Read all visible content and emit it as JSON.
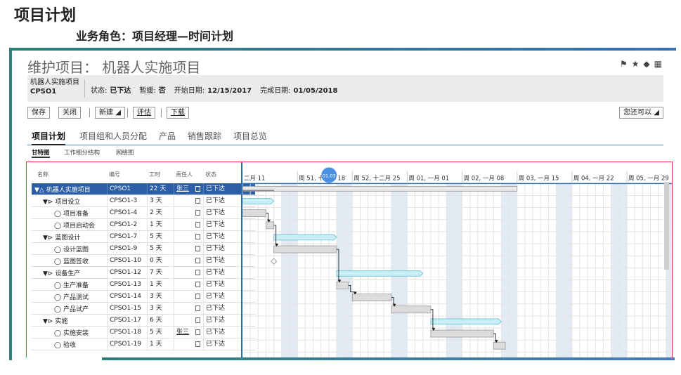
{
  "slide": {
    "title": "项目计划",
    "subtitle": "业务角色：项目经理—时间计划"
  },
  "app": {
    "title": "维护项目： 机器人实施项目",
    "header_icons": [
      "flag-icon",
      "star-icon",
      "tag-icon",
      "grid-icon"
    ],
    "info": {
      "name": "机器人实施项目",
      "code": "CPSO1",
      "status_label": "状态:",
      "status_value": "已下达",
      "pause_label": "暂缓:",
      "pause_value": "否",
      "start_label": "开始日期:",
      "start_value": "12/15/2017",
      "end_label": "完成日期:",
      "end_value": "01/05/2018"
    },
    "toolbar": {
      "save": "保存",
      "close": "关闭",
      "new": "新建",
      "evaluate": "评估",
      "download": "下载",
      "more": "您还可以"
    },
    "tabs": [
      "项目计划",
      "项目组和人员分配",
      "产品",
      "销售跟踪",
      "项目总览"
    ],
    "subtabs": [
      "甘特图",
      "工作细分结构",
      "网络图"
    ]
  },
  "table": {
    "columns": [
      "名称",
      "编号",
      "工时",
      "责任人",
      "状态"
    ],
    "rows": [
      {
        "name": "机器人实施项目",
        "code": "CPSO1",
        "dur": "22 天",
        "owner": "张三",
        "status": "已下达",
        "level": 0,
        "type": "project"
      },
      {
        "name": "项目设立",
        "code": "CPSO1-3",
        "dur": "3 天",
        "owner": "",
        "status": "已下达",
        "level": 1,
        "type": "phase"
      },
      {
        "name": "项目准备",
        "code": "CPSO1-4",
        "dur": "2 天",
        "owner": "",
        "status": "已下达",
        "level": 2,
        "type": "task"
      },
      {
        "name": "项目启动会",
        "code": "CPSO1-2",
        "dur": "1 天",
        "owner": "",
        "status": "已下达",
        "level": 2,
        "type": "task"
      },
      {
        "name": "蓝图设计",
        "code": "CPSO1-7",
        "dur": "5 天",
        "owner": "",
        "status": "已下达",
        "level": 1,
        "type": "phase"
      },
      {
        "name": "设计蓝图",
        "code": "CPSO1-9",
        "dur": "5 天",
        "owner": "",
        "status": "已下达",
        "level": 2,
        "type": "task"
      },
      {
        "name": "蓝图签收",
        "code": "CPSO1-10",
        "dur": "0 天",
        "owner": "",
        "status": "已下达",
        "level": 2,
        "type": "task"
      },
      {
        "name": "设备生产",
        "code": "CPSO1-12",
        "dur": "7 天",
        "owner": "",
        "status": "已下达",
        "level": 1,
        "type": "phase"
      },
      {
        "name": "生产准备",
        "code": "CPSO1-13",
        "dur": "1 天",
        "owner": "",
        "status": "已下达",
        "level": 2,
        "type": "task"
      },
      {
        "name": "产品测试",
        "code": "CPSO1-14",
        "dur": "3 天",
        "owner": "",
        "status": "已下达",
        "level": 2,
        "type": "task"
      },
      {
        "name": "产品试产",
        "code": "CPSO1-15",
        "dur": "3 天",
        "owner": "",
        "status": "已下达",
        "level": 2,
        "type": "task"
      },
      {
        "name": "实施",
        "code": "CPSO1-17",
        "dur": "6 天",
        "owner": "",
        "status": "已下达",
        "level": 1,
        "type": "phase"
      },
      {
        "name": "实施安装",
        "code": "CPSO1-18",
        "dur": "5 天",
        "owner": "张三",
        "status": "已下达",
        "level": 2,
        "type": "task"
      },
      {
        "name": "验收",
        "code": "CPSO1-19",
        "dur": "1 天",
        "owner": "",
        "status": "已下达",
        "level": 2,
        "type": "task"
      }
    ]
  },
  "gantt": {
    "weeks": [
      "二月 11",
      "周 51, 十二月 18",
      "周 52, 十二月 25",
      "周 01, 一月 01",
      "周 02, 一月 08",
      "周 03, 一月 15",
      "周 04, 一月 22",
      "周 05, 一月 29"
    ],
    "today_marker": "01.03",
    "bars": [
      {
        "row": 0,
        "start": 0,
        "days": 35,
        "kind": "summary"
      },
      {
        "row": 1,
        "start": 0,
        "days": 4,
        "kind": "phase"
      },
      {
        "row": 2,
        "start": 0,
        "days": 3,
        "kind": "task"
      },
      {
        "row": 3,
        "start": 3,
        "days": 1,
        "kind": "task"
      },
      {
        "row": 4,
        "start": 4,
        "days": 8,
        "kind": "phase"
      },
      {
        "row": 5,
        "start": 4,
        "days": 8,
        "kind": "task"
      },
      {
        "row": 6,
        "start": 4,
        "days": 0,
        "kind": "milestone"
      },
      {
        "row": 7,
        "start": 12,
        "days": 11,
        "kind": "phase"
      },
      {
        "row": 8,
        "start": 12,
        "days": 1.5,
        "kind": "task"
      },
      {
        "row": 9,
        "start": 14,
        "days": 5,
        "kind": "task"
      },
      {
        "row": 10,
        "start": 19,
        "days": 5,
        "kind": "task"
      },
      {
        "row": 11,
        "start": 24,
        "days": 9,
        "kind": "phase"
      },
      {
        "row": 12,
        "start": 24,
        "days": 8,
        "kind": "task"
      },
      {
        "row": 13,
        "start": 32,
        "days": 1.5,
        "kind": "task"
      }
    ],
    "links": [
      [
        2,
        3
      ],
      [
        3,
        5
      ],
      [
        5,
        8
      ],
      [
        8,
        9
      ],
      [
        9,
        10
      ],
      [
        10,
        12
      ],
      [
        12,
        13
      ]
    ],
    "colors": {
      "phase": "#c8eef5",
      "phase_border": "#6bbfd0",
      "task": "#dcdcdc",
      "task_border": "#999999",
      "summary": "#e8e8e8",
      "weekend": "#e2eaf4",
      "marker": "#4a90e2"
    }
  }
}
